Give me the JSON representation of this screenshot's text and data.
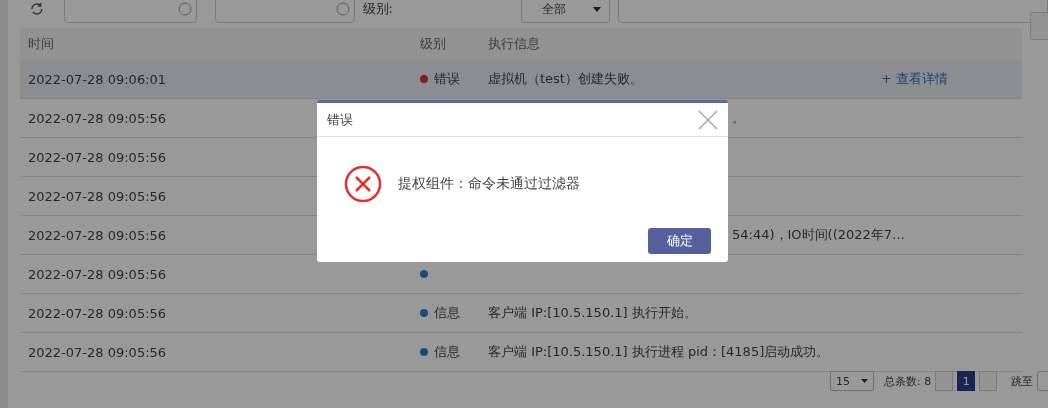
{
  "toolbar": {
    "level_label": "级别:",
    "level_value": "全部"
  },
  "table": {
    "columns": [
      "时间",
      "级别",
      "执行信息"
    ],
    "rows": [
      {
        "time": "2022-07-28 09:06:01",
        "color": "#821d19",
        "level": "错误",
        "message": "虚拟机（test）创建失败。",
        "link": "+ 查看详情",
        "selected": true
      },
      {
        "time": "2022-07-28 09:05:56",
        "message_tail": "。",
        "selected": false
      },
      {
        "time": "2022-07-28 09:05:56",
        "selected": false
      },
      {
        "time": "2022-07-28 09:05:56",
        "selected": false
      },
      {
        "time": "2022-07-28 09:05:56",
        "message_tail": "54:44)，IO时间((2022年7…",
        "selected": false
      },
      {
        "time": "2022-07-28 09:05:56",
        "color": "#1c4c7d",
        "selected": false
      },
      {
        "time": "2022-07-28 09:05:56",
        "color": "#1c4c7d",
        "level": "信息",
        "message": "客户端 IP:[10.5.150.1] 执行开始。",
        "selected": false
      },
      {
        "time": "2022-07-28 09:05:56",
        "color": "#1c4c7d",
        "level": "信息",
        "message": "客户端 IP:[10.5.150.1] 执行进程 pid：[4185]启动成功。",
        "selected": false
      }
    ]
  },
  "pagination": {
    "page_size": "15",
    "total": "总条数: 8",
    "pages": [
      {
        "label": "1",
        "selected": true
      }
    ],
    "jump_label": "跳至"
  },
  "dialog": {
    "title": "错误",
    "message": "提权组件：命令未通过过滤器",
    "ok": "确定"
  }
}
